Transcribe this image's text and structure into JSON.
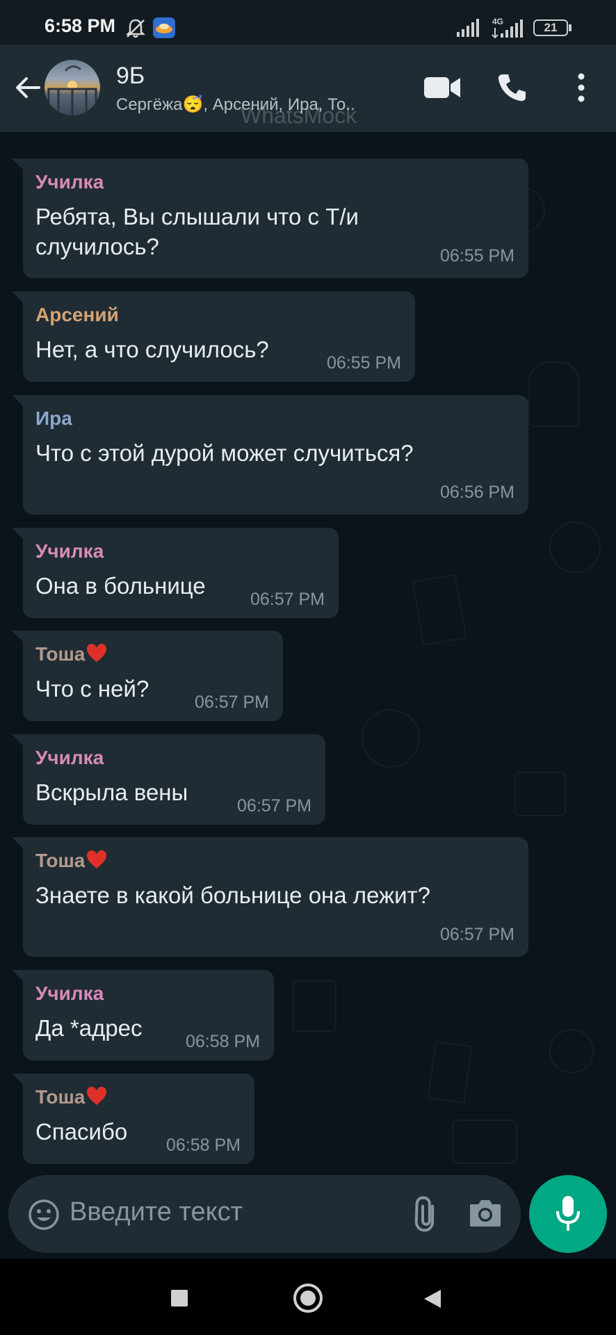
{
  "status_bar": {
    "time": "6:58 PM",
    "network": "4G",
    "battery": "21"
  },
  "header": {
    "title": "9Б",
    "subtitle": "Сергёжа😴, Арсений, Ира, То..",
    "watermark": "WhatsMock"
  },
  "messages": [
    {
      "sender": "Училка",
      "sender_color": "#d88bb9",
      "text_lines": [
        "Ребята, Вы слышали что с Т/и",
        "случилось?"
      ],
      "time": "06:55 PM"
    },
    {
      "sender": "Арсений",
      "sender_color": "#d4a373",
      "text_lines": [
        "Нет, а что случилось?"
      ],
      "time": "06:55 PM"
    },
    {
      "sender": "Ира",
      "sender_color": "#8da6d0",
      "text_lines": [
        "Что с этой дурой может случиться?"
      ],
      "time": "06:56 PM"
    },
    {
      "sender": "Училка",
      "sender_color": "#d88bb9",
      "text_lines": [
        "Она в больнице"
      ],
      "time": "06:57 PM"
    },
    {
      "sender": "Тоша",
      "sender_color": "#b39a8d",
      "sender_heart": true,
      "text_lines": [
        "Что с ней?"
      ],
      "time": "06:57 PM"
    },
    {
      "sender": "Училка",
      "sender_color": "#d88bb9",
      "text_lines": [
        "Вскрыла вены"
      ],
      "time": "06:57 PM"
    },
    {
      "sender": "Тоша",
      "sender_color": "#b39a8d",
      "sender_heart": true,
      "text_lines": [
        "Знаете в какой больнице она лежит?"
      ],
      "time": "06:57 PM"
    },
    {
      "sender": "Училка",
      "sender_color": "#d88bb9",
      "text_lines": [
        "Да *адрес"
      ],
      "time": "06:58 PM"
    },
    {
      "sender": "Тоша",
      "sender_color": "#b39a8d",
      "sender_heart": true,
      "text_lines": [
        "Спасибо"
      ],
      "time": "06:58 PM"
    }
  ],
  "input": {
    "placeholder": "Введите текст"
  },
  "icons": {
    "back": "arrow-left-icon",
    "video": "video-camera-icon",
    "call": "phone-icon",
    "menu": "more-vert-icon",
    "emoji": "emoji-icon",
    "attach": "paperclip-icon",
    "camera": "camera-icon",
    "mic": "microphone-icon"
  },
  "colors": {
    "background": "#0b141a",
    "header": "#1f2c33",
    "bubble": "#1f2c34",
    "accent": "#00a884",
    "heart": "#e0302a"
  }
}
